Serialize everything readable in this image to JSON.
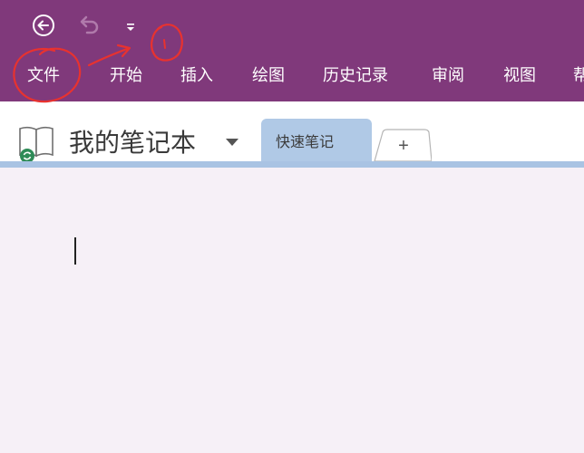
{
  "colors": {
    "ribbon": "#80397b",
    "section_tab": "#b0c9e6",
    "page_background": "#f6f0f7",
    "annotation": "#e8322f"
  },
  "quick_access": {
    "back_icon": "back-arrow-circle-icon",
    "undo_icon": "undo-icon",
    "customize_icon": "customize-quick-access-icon"
  },
  "menu": {
    "file": "文件",
    "home": "开始",
    "insert": "插入",
    "draw": "绘图",
    "history": "历史记录",
    "review": "审阅",
    "view": "视图",
    "help": "帮"
  },
  "notebook": {
    "title": "我的笔记本",
    "icon": "notebook-sync-icon",
    "dropdown_icon": "caret-down-icon"
  },
  "sections": {
    "active_tab": "快速笔记",
    "add_button": "+"
  },
  "annotations": {
    "marks": [
      "circle around file tab",
      "arrow pointing right",
      "circle around customize button"
    ]
  }
}
